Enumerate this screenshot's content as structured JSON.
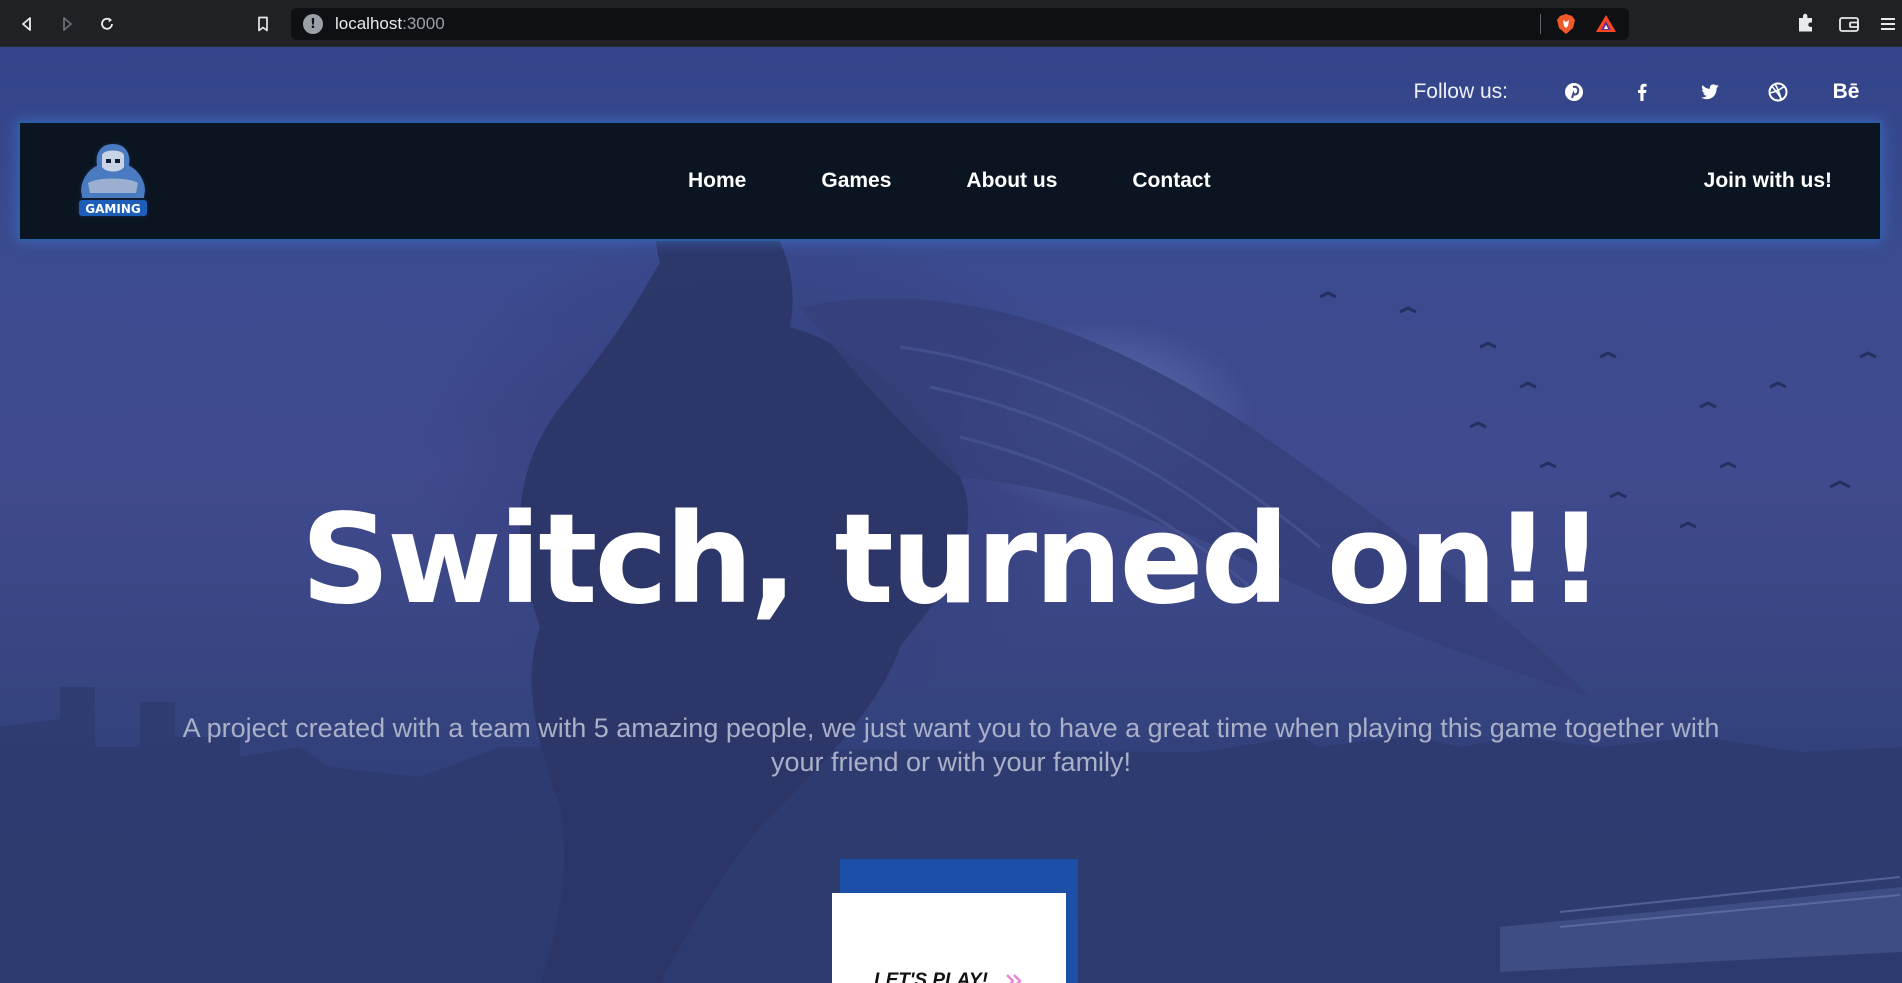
{
  "browser": {
    "url_host": "localhost",
    "url_port": ":3000",
    "icons": [
      "back-icon",
      "forward-icon",
      "reload-icon",
      "bookmark-icon",
      "site-info-icon",
      "brave-shields-icon",
      "brave-rewards-icon",
      "extensions-icon",
      "wallet-icon",
      "menu-icon"
    ]
  },
  "social": {
    "label": "Follow us:",
    "items": [
      "pinterest-icon",
      "facebook-icon",
      "twitter-icon",
      "dribbble-icon",
      "behance-icon"
    ],
    "behance_text": "Bē"
  },
  "navbar": {
    "links": [
      "Home",
      "Games",
      "About us",
      "Contact"
    ],
    "join": "Join with us!",
    "logo_text": "GAMING",
    "border_color": "#2c5ea8",
    "background": "#0b1522"
  },
  "hero": {
    "headline": "Switch, turned on!!",
    "subtitle": "A project created with a team with 5 amazing people, we just want you to have a great time when playing this game together with your friend or with your family!",
    "cta_label": "LET'S PLAY!",
    "cta_arrow_color": "#e58ad6",
    "cta_shadow_color": "#1b4fa8"
  }
}
